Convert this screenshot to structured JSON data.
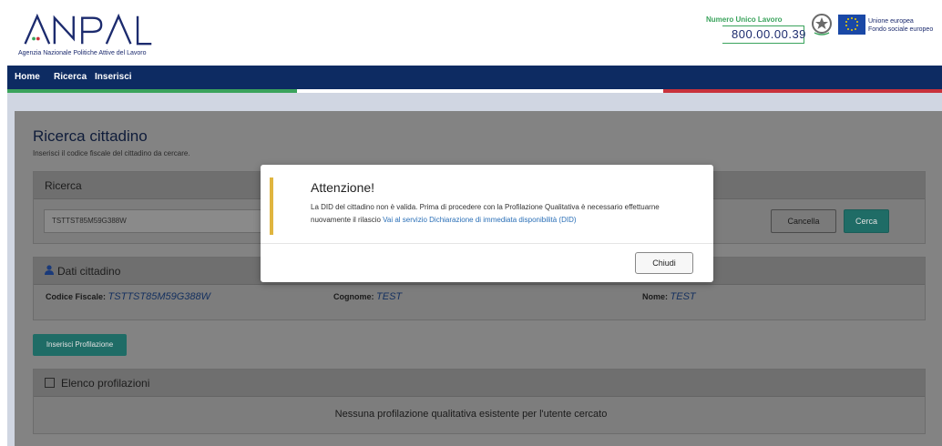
{
  "header": {
    "logo_text": "ANPAL",
    "logo_subtitle": "Agenzia Nazionale Politiche Attive del Lavoro",
    "numero_label": "Numero Unico Lavoro",
    "numero_value": "800.00.00.39",
    "eu_line1": "Unione europea",
    "eu_line2": "Fondo sociale europeo"
  },
  "nav": {
    "items": [
      "Home",
      "Ricerca",
      "Inserisci"
    ]
  },
  "page": {
    "title": "Ricerca cittadino",
    "subtitle": "Inserisci il codice fiscale del cittadino da cercare."
  },
  "search_panel": {
    "title": "Ricerca",
    "input_value": "TSTTST85M59G388W",
    "cancel_label": "Cancella",
    "search_label": "Cerca"
  },
  "dati_panel": {
    "title": "Dati cittadino",
    "codice_fiscale_label": "Codice Fiscale:",
    "codice_fiscale_value": "TSTTST85M59G388W",
    "cognome_label": "Cognome:",
    "cognome_value": "TEST",
    "nome_label": "Nome:",
    "nome_value": "TEST"
  },
  "insert_button_label": "Inserisci Profilazione",
  "profilazioni_panel": {
    "title": "Elenco profilazioni",
    "empty_message": "Nessuna profilazione qualitativa esistente per l'utente cercato"
  },
  "modal": {
    "title": "Attenzione!",
    "text": "La DID del cittadino non è valida. Prima di procedere con la Profilazione Qualitativa è necessario effettuarne nuovamente il rilascio ",
    "link": "Vai al servizio Dichiarazione di immediata disponibilità (DID)",
    "close_label": "Chiudi"
  },
  "colors": {
    "nav_bg": "#0d2b62",
    "accent_teal": "#1f6c66",
    "warning_bar": "#e0b53f",
    "link": "#2a6fb7",
    "stripe_green": "#3aa35c",
    "stripe_red": "#c8323c"
  }
}
